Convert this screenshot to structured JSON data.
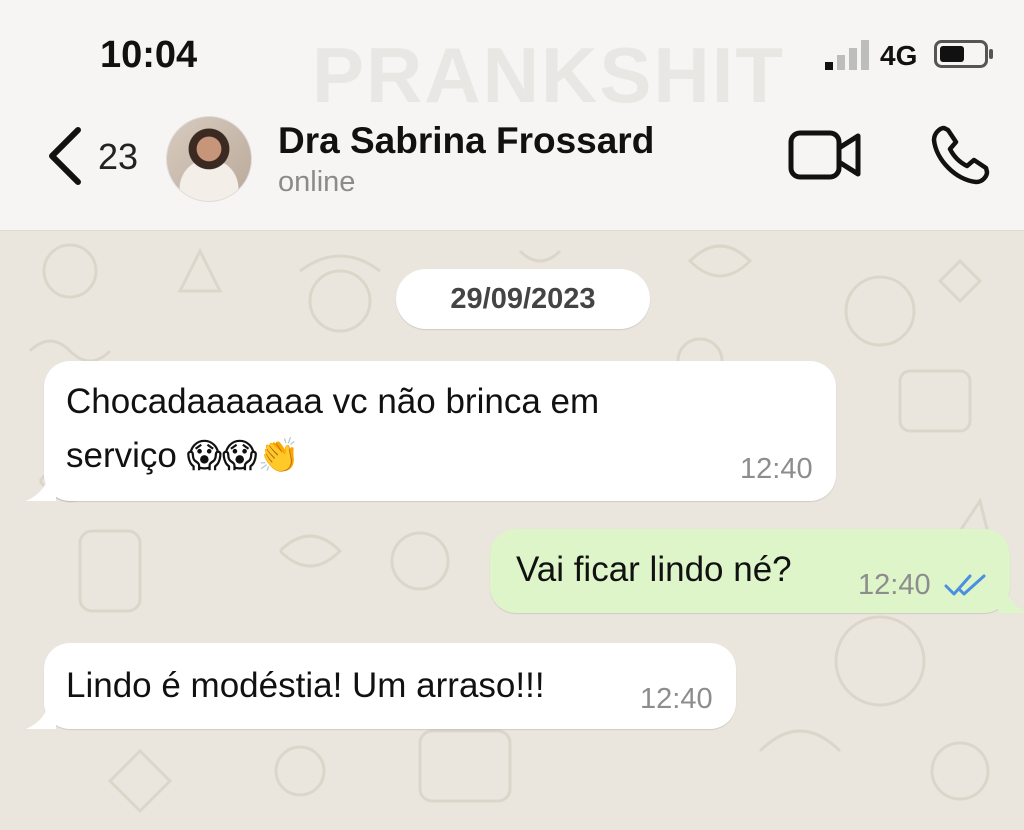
{
  "status_bar": {
    "time": "10:04",
    "network": "4G",
    "watermark": "PRANKSHIT"
  },
  "header": {
    "back_count": "23",
    "contact_name": "Dra Sabrina Frossard",
    "contact_status": "online",
    "icons": [
      "chevron-left-icon",
      "video-camera-icon",
      "phone-icon"
    ]
  },
  "chat": {
    "date": "29/09/2023",
    "messages": [
      {
        "direction": "incoming",
        "text": "Chocadaaaaaaa vc não brinca em serviço",
        "emojis": "😱😱👏",
        "time": "12:40"
      },
      {
        "direction": "outgoing",
        "text": "Vai ficar lindo né?",
        "time": "12:40",
        "read": true
      },
      {
        "direction": "incoming",
        "text": "Lindo é modéstia! Um arraso!!!",
        "time": "12:40"
      }
    ]
  },
  "colors": {
    "outgoing_bubble": "#ddf5c9",
    "incoming_bubble": "#ffffff",
    "read_ticks": "#4a8fe0",
    "chat_background": "#ebe6dd"
  }
}
